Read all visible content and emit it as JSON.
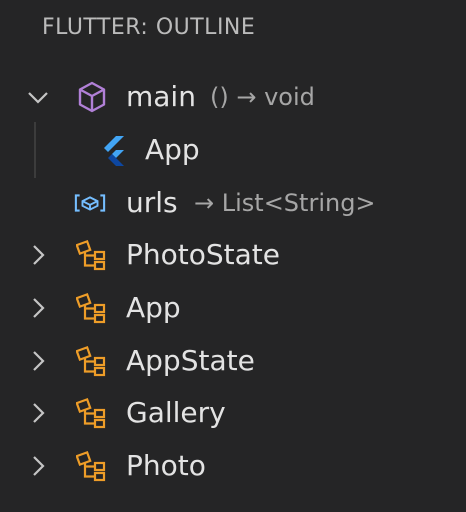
{
  "panel": {
    "title": "FLUTTER: OUTLINE"
  },
  "outline": {
    "main": {
      "label": "main",
      "detail": "() → void",
      "icon": "method-cube-icon",
      "expanded": true
    },
    "app_widget": {
      "label": "App",
      "icon": "flutter-logo-icon"
    },
    "urls": {
      "label": "urls",
      "detail": "→ List<String>",
      "icon": "variable-icon"
    },
    "classes": [
      {
        "label": "PhotoState",
        "icon": "class-icon",
        "expanded": false
      },
      {
        "label": "App",
        "icon": "class-icon",
        "expanded": false
      },
      {
        "label": "AppState",
        "icon": "class-icon",
        "expanded": false
      },
      {
        "label": "Gallery",
        "icon": "class-icon",
        "expanded": false
      },
      {
        "label": "Photo",
        "icon": "class-icon",
        "expanded": false
      }
    ]
  },
  "colors": {
    "background": "#252526",
    "method_icon": "#b180d7",
    "flutter_icon": "#42a5f5",
    "variable_icon": "#75beff",
    "class_icon": "#ee9d28"
  }
}
